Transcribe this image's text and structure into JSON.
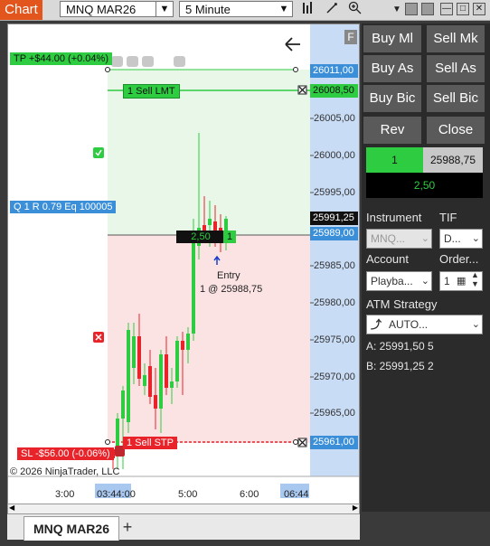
{
  "toolbar": {
    "chart_label": "Chart",
    "instrument": "MNQ MAR26",
    "interval": "5 Minute",
    "dropdown_arrow": "▼"
  },
  "chart": {
    "tp_label": "TP +$44.00 (+0.04%)",
    "sl_label": "SL -$56.00 (-0.06%)",
    "position_label": "Q 1 R 0.79 Eq 100005",
    "sell_lmt_label": "1 Sell LMT",
    "sell_stp_label": "1 Sell STP",
    "pnl_label": "2,50",
    "qty_label": "1",
    "entry_label": "Entry",
    "entry_detail": "1 @ 25988,75",
    "copyright": "© 2026 NinjaTrader, LLC",
    "f_button": "F",
    "price_axis": [
      "26005,00",
      "26000,00",
      "25995,00",
      "25985,00",
      "25980,00",
      "25975,00",
      "25970,00",
      "25965,00"
    ],
    "price_tp": "26011,00",
    "price_lmt": "26008,50",
    "price_current": "25991,25",
    "price_entry": "25989,00",
    "price_stp": "25961,00",
    "time_axis": [
      "3:00",
      "03:44:00",
      "5:00",
      "6:00",
      "06:44"
    ]
  },
  "panel": {
    "buy_mkt": "Buy Ml",
    "sell_mkt": "Sell Mk",
    "buy_ask": "Buy As",
    "sell_ask": "Sell As",
    "buy_bid": "Buy Bic",
    "sell_bid": "Sell Bic",
    "rev": "Rev",
    "close": "Close",
    "position_qty": "1",
    "position_price": "25988,75",
    "position_pnl": "2,50",
    "instrument_label": "Instrument",
    "tif_label": "TIF",
    "instrument_value": "MNQ...",
    "tif_value": "D...",
    "account_label": "Account",
    "order_label": "Order...",
    "account_value": "Playba...",
    "order_qty": "1",
    "atm_label": "ATM Strategy",
    "atm_value": "AUTO...",
    "ask_label": "A: 25991,50   5",
    "bid_label": "B: 25991,25   2"
  },
  "tabs": {
    "main": "MNQ MAR26",
    "add": "+"
  },
  "colors": {
    "accent": "#e2551c",
    "buy_green": "#2ecc40",
    "sell_red": "#e8232a",
    "axis_blue": "#c9dcf5"
  }
}
